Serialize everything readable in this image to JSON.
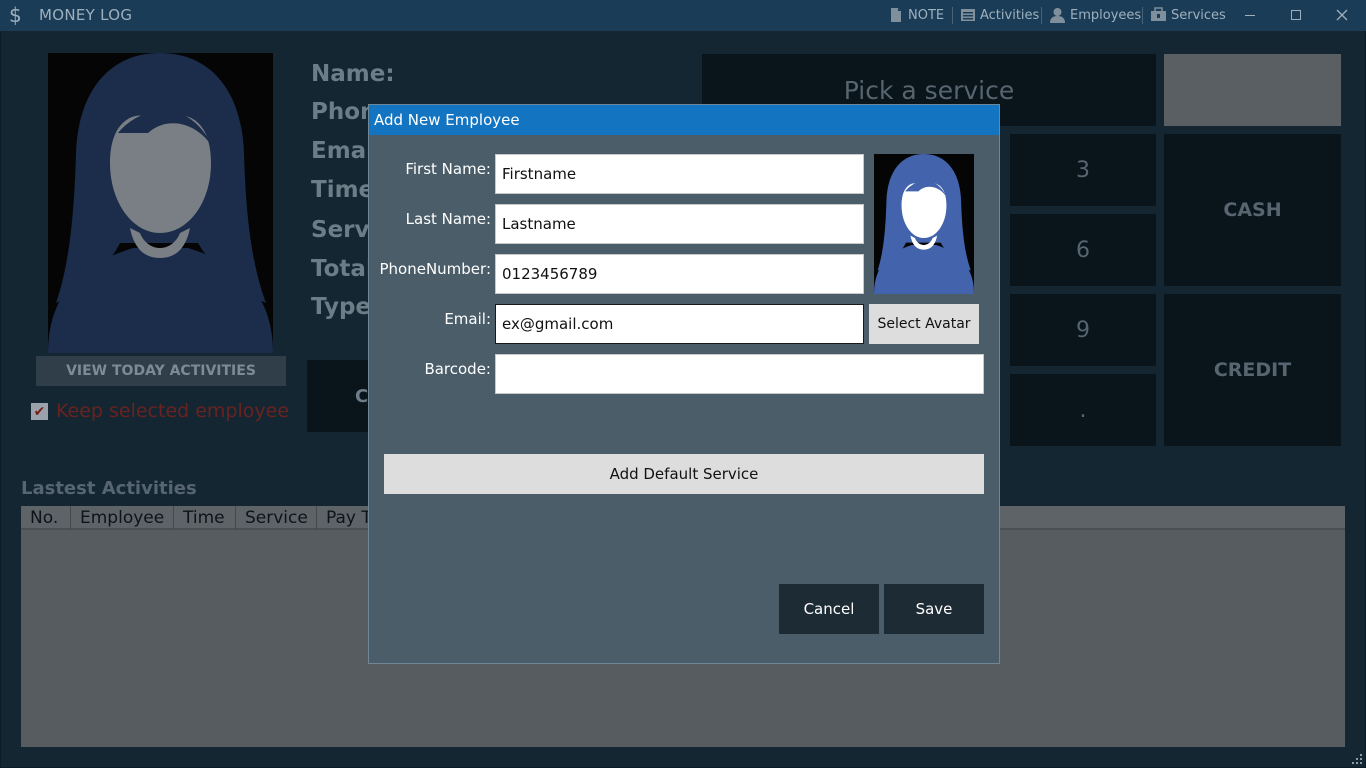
{
  "titlebar": {
    "app_icon": "$",
    "title": "MONEY LOG",
    "menu": [
      {
        "label": "NOTE",
        "icon": "note-icon"
      },
      {
        "label": "Activities",
        "icon": "list-icon"
      },
      {
        "label": "Employees",
        "icon": "person-icon"
      },
      {
        "label": "Services",
        "icon": "services-icon"
      }
    ]
  },
  "main": {
    "view_today_label": "VIEW TODAY ACTIVITIES",
    "keep_selected_label": "Keep selected employee",
    "keep_selected_checked": true,
    "info_labels": [
      "Name:",
      "Phon",
      "Emai",
      "Time",
      "Servi",
      "Total",
      "Type"
    ],
    "c_button_label": "C",
    "service_placeholder": "Pick a service",
    "num_keys": [
      "3",
      "6",
      "9",
      "."
    ],
    "pay_buttons": [
      "CASH",
      "CREDIT"
    ],
    "latest_title": "Lastest Activities",
    "grid_columns": [
      "No.",
      "Employee",
      "Time",
      "Service",
      "Pay T"
    ]
  },
  "dialog": {
    "title": "Add New Employee",
    "first_name_label": "First Name:",
    "first_name_value": "Firstname",
    "last_name_label": "Last Name:",
    "last_name_value": "Lastname",
    "phone_label": "PhoneNumber:",
    "phone_value": "0123456789",
    "email_label": "Email:",
    "email_value": "ex@gmail.com",
    "barcode_label": "Barcode:",
    "barcode_value": "",
    "select_avatar_label": "Select Avatar",
    "add_default_service_label": "Add Default Service",
    "cancel_label": "Cancel",
    "save_label": "Save"
  },
  "colors": {
    "titlebar": "#1a3c57",
    "dialog_bg": "#4a5d69",
    "dialog_titlebar": "#1374c1",
    "avatar_fill_dim": "#1b2d4a",
    "avatar_fill": "#4363ad",
    "avatar_face_dim": "#7a7f85",
    "dialog_button": "#1d2b34"
  }
}
